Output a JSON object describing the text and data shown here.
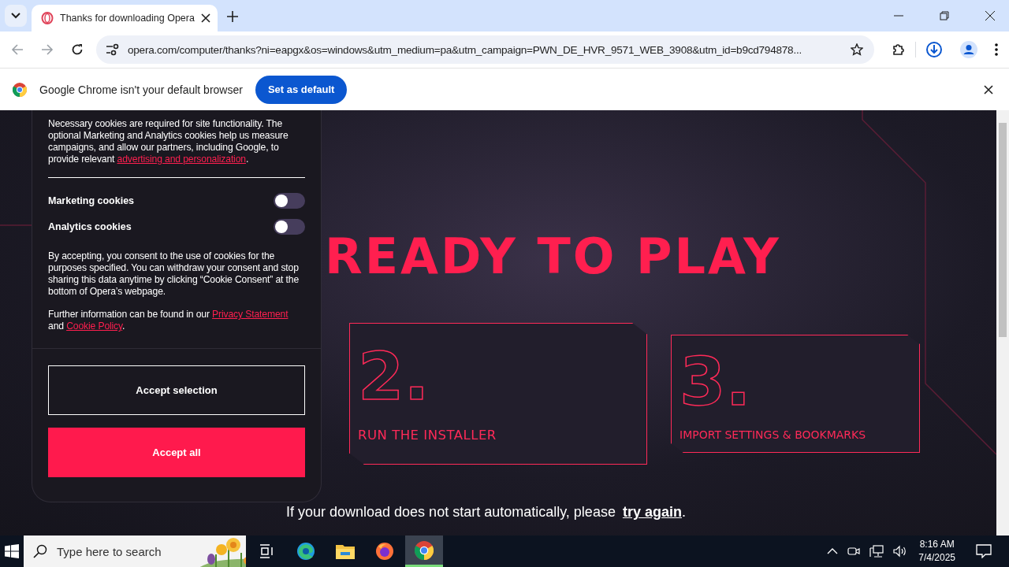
{
  "browser": {
    "tabs": [
      {
        "title": "Thanks for downloading Opera",
        "selected": true
      }
    ],
    "address": "opera.com/computer/thanks?ni=eapgx&os=windows&utm_medium=pa&utm_campaign=PWN_DE_HVR_9571_WEB_3908&utm_id=b9cd794878...",
    "infobar": {
      "message": "Google Chrome isn't your default browser",
      "button": "Set as default"
    }
  },
  "cookie_panel": {
    "intro": {
      "text": "Necessary cookies are required for site functionality. The optional Marketing and Analytics cookies help us measure campaigns, and allow our partners, including Google, to provide relevant ",
      "link": "advertising and personalization",
      "after": "."
    },
    "toggles": [
      {
        "label": "Marketing cookies",
        "on": false
      },
      {
        "label": "Analytics cookies",
        "on": false
      }
    ],
    "consent": "By accepting, you consent to the use of cookies for the purposes specified. You can withdraw your consent and stop sharing this data anytime by clicking “Cookie Consent” at the bottom of Opera’s webpage.",
    "further": {
      "text": "Further information can be found in our ",
      "link1": "Privacy Statement",
      "middle": " and ",
      "link2": "Cookie Policy",
      "after": "."
    },
    "buttons": [
      {
        "label": "Accept selection",
        "kind": "outline"
      },
      {
        "label": "Accept all",
        "kind": "filled"
      }
    ]
  },
  "hero": {
    "title": "READY TO PLAY",
    "steps": [
      {
        "number": "2.",
        "label": "RUN THE INSTALLER"
      },
      {
        "number": "3.",
        "label": "IMPORT SETTINGS & BOOKMARKS"
      }
    ],
    "footer": {
      "text": "If your download does not start automatically, please ",
      "link": "try again",
      "after": "."
    }
  },
  "taskbar": {
    "search_placeholder": "Type here to search",
    "apps": [
      {
        "kind": "taskview",
        "selected": false
      },
      {
        "kind": "edge",
        "selected": false
      },
      {
        "kind": "explorer",
        "selected": false
      },
      {
        "kind": "firefox",
        "selected": false
      },
      {
        "kind": "chrome",
        "selected": true
      }
    ],
    "time": "8:16 AM",
    "date": "7/4/2025"
  }
}
